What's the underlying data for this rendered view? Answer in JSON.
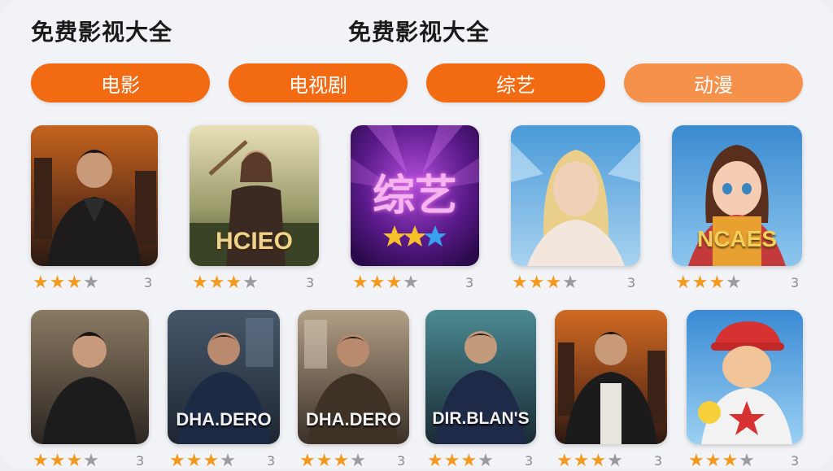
{
  "header": {
    "title_left": "免费影视大全",
    "title_center": "免费影视大全"
  },
  "tabs": [
    {
      "label": "电影",
      "color": "#f26a12"
    },
    {
      "label": "电视剧",
      "color": "#f26a12"
    },
    {
      "label": "综艺",
      "color": "#f26a12"
    },
    {
      "label": "动漫",
      "color": "#f5914a"
    }
  ],
  "colors": {
    "accent": "#f26a12",
    "star_on": "#f29a1f",
    "star_off": "#9a9aa0"
  },
  "row1": [
    {
      "poster_text": "",
      "stars": 3,
      "max_stars": 4,
      "count": "3"
    },
    {
      "poster_text": "HCIEO",
      "stars": 3,
      "max_stars": 4,
      "count": "3"
    },
    {
      "poster_text": "综艺",
      "stars": 3,
      "max_stars": 4,
      "count": "3"
    },
    {
      "poster_text": "",
      "stars": 3,
      "max_stars": 4,
      "count": "3"
    },
    {
      "poster_text": "NCAES",
      "stars": 3,
      "max_stars": 4,
      "count": "3"
    }
  ],
  "row2": [
    {
      "poster_text": "",
      "stars": 3,
      "max_stars": 4,
      "count": "3"
    },
    {
      "poster_text": "DHA.DERO",
      "stars": 3,
      "max_stars": 4,
      "count": "3"
    },
    {
      "poster_text": "DHA.DERO",
      "stars": 3,
      "max_stars": 4,
      "count": "3"
    },
    {
      "poster_text": "DIR.BLAN'S",
      "stars": 3,
      "max_stars": 4,
      "count": "3"
    },
    {
      "poster_text": "",
      "stars": 3,
      "max_stars": 4,
      "count": "3"
    },
    {
      "poster_text": "",
      "stars": 3,
      "max_stars": 4,
      "count": "3"
    }
  ]
}
